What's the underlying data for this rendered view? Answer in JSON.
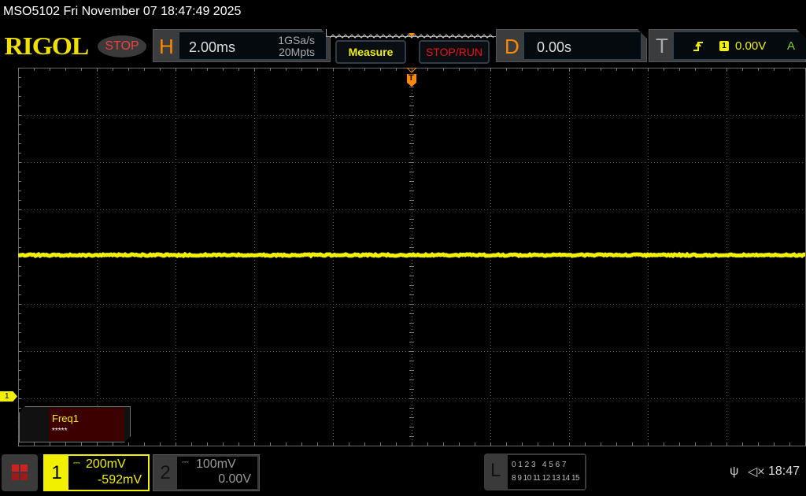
{
  "title_bar": "MSO5102  Fri November 07 18:47:49 2025",
  "logo": "RIGOL",
  "run_status": "STOP",
  "horizontal": {
    "letter": "H",
    "timebase": "2.00ms",
    "sample_rate": "1GSa/s",
    "memory_depth": "20Mpts"
  },
  "buttons": {
    "measure": "Measure",
    "stop_run": "STOP/RUN"
  },
  "delay": {
    "letter": "D",
    "value": "0.00s"
  },
  "trigger": {
    "letter": "T",
    "edge_icon": "rising-edge-icon",
    "source": "1",
    "level": "0.00V",
    "mode": "A"
  },
  "trigger_marker": "T",
  "grid": {
    "h_divisions": 10,
    "v_divisions": 8
  },
  "trace": {
    "color": "#f0f000",
    "level_div_from_top": 4.0
  },
  "ch1_marker": "1",
  "measurement": {
    "label": "Freq1",
    "value": "*****"
  },
  "channels": [
    {
      "number": "1",
      "scale": "200mV",
      "offset": "-592mV",
      "color": "#f0f000",
      "active": true
    },
    {
      "number": "2",
      "scale": "100mV",
      "offset": "0.00V",
      "color": "#888888",
      "active": false
    }
  ],
  "logic": {
    "letter": "L",
    "row1": "0 1 2 3   4 5 6 7",
    "row2": "8 9 10 11 12 13 14 15"
  },
  "status": {
    "usb_icon": "usb-icon",
    "sound_icon": "speaker-muted-icon",
    "time": "18:47"
  }
}
